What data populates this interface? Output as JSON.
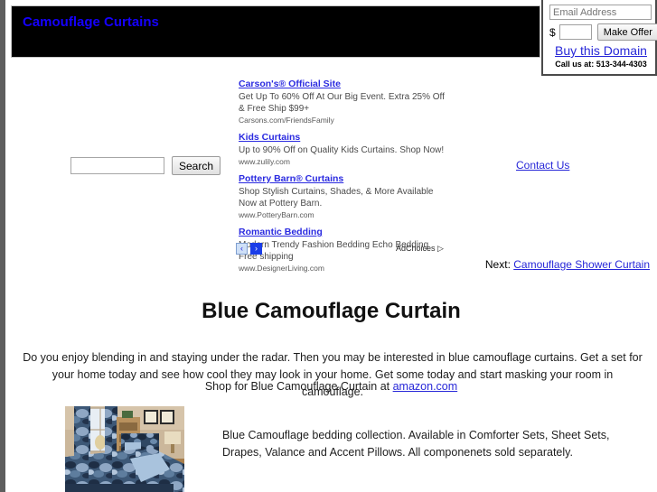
{
  "site": {
    "title": "Camouflage Curtains"
  },
  "domain_offer": {
    "email_placeholder": "Email Address",
    "email_value": "",
    "currency_symbol": "$",
    "offer_value": "",
    "offer_placeholder": "",
    "make_offer_label": "Make Offer",
    "buy_domain_label": "Buy this Domain",
    "call_us_label": "Call us at: 513-344-4303"
  },
  "search": {
    "value": "",
    "placeholder": "",
    "button_label": "Search"
  },
  "ads": {
    "items": [
      {
        "title": "Carson's® Official Site",
        "description": "Get Up To 60% Off At Our Big Event. Extra 25% Off & Free Ship $99+",
        "url": "Carsons.com/FriendsFamily"
      },
      {
        "title": "Kids Curtains",
        "description": "Up to 90% Off on Quality Kids Curtains. Shop Now!",
        "url": "www.zulily.com"
      },
      {
        "title": "Pottery Barn® Curtains",
        "description": "Shop Stylish Curtains, Shades, & More Available Now at Pottery Barn.",
        "url": "www.PotteryBarn.com"
      },
      {
        "title": "Romantic Bedding",
        "description": "Modern Trendy Fashion Bedding Echo Bedding Free shipping",
        "url": "www.DesignerLiving.com"
      }
    ],
    "prev_icon": "‹",
    "next_icon": "›",
    "adchoices_label": "AdChoices",
    "adchoices_icon": "▷"
  },
  "links": {
    "contact_us": "Contact Us",
    "next_prefix": "Next:",
    "next_link": "Camouflage Shower Curtain"
  },
  "main": {
    "heading": "Blue Camouflage Curtain",
    "intro_paragraph": "Do you enjoy blending in and staying under the radar. Then you may be interested in blue camouflage curtains. Get a set for your home today and see how cool they may look in your home. Get some today and start masking your room in camouflage.",
    "shop_prefix": "Shop for Blue Camouflage Curtain at",
    "shop_link": "amazon.com",
    "product_description": "Blue Camouflage bedding collection. Available in Comforter Sets, Sheet Sets, Drapes, Valance and Accent Pillows. All componenets sold separately."
  },
  "colors": {
    "header_background": "#000000",
    "title_text": "#1500ff",
    "link": "#2727d8",
    "ad_link": "#2a2ae0",
    "page_border": "#5e5e5e"
  }
}
